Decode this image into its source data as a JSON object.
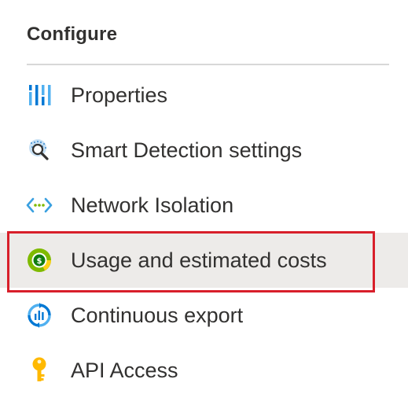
{
  "section": {
    "title": "Configure"
  },
  "menu": {
    "items": [
      {
        "label": "Properties",
        "icon": "properties-icon"
      },
      {
        "label": "Smart Detection settings",
        "icon": "smart-detection-icon"
      },
      {
        "label": "Network Isolation",
        "icon": "network-isolation-icon"
      },
      {
        "label": "Usage and estimated costs",
        "icon": "usage-costs-icon",
        "selected": true
      },
      {
        "label": "Continuous export",
        "icon": "continuous-export-icon"
      },
      {
        "label": "API Access",
        "icon": "key-icon"
      }
    ]
  },
  "colors": {
    "highlight_border": "#d81f2a",
    "selected_background": "#edebe9",
    "text": "#323130",
    "accent_blue": "#0078d4"
  }
}
